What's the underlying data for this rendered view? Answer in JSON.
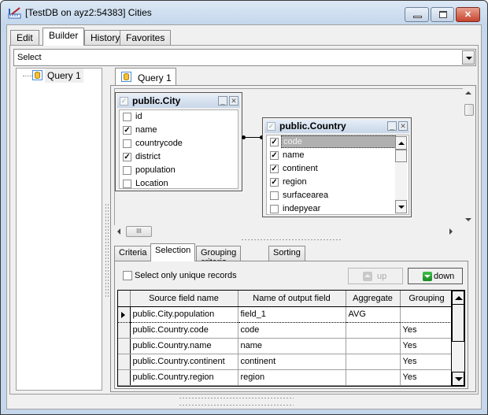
{
  "window": {
    "title": "[TestDB on ayz2:54383] Cities",
    "controls": {
      "minimize": "minimize",
      "maximize": "maximize",
      "close": "close"
    }
  },
  "top_tabs": [
    {
      "label": "Edit",
      "active": false
    },
    {
      "label": "Builder",
      "active": true
    },
    {
      "label": "History",
      "active": false
    },
    {
      "label": "Favorites",
      "active": false
    }
  ],
  "query_type": {
    "selected": "Select"
  },
  "tree": {
    "items": [
      {
        "label": "Query 1"
      }
    ]
  },
  "query_tab": {
    "label": "Query 1"
  },
  "diagram": {
    "tables": [
      {
        "name": "public.City",
        "fields": [
          {
            "name": "id",
            "checked": false
          },
          {
            "name": "name",
            "checked": true
          },
          {
            "name": "countrycode",
            "checked": false
          },
          {
            "name": "district",
            "checked": true
          },
          {
            "name": "population",
            "checked": false
          },
          {
            "name": "Location",
            "checked": false
          }
        ]
      },
      {
        "name": "public.Country",
        "fields": [
          {
            "name": "code",
            "checked": true,
            "selected": true
          },
          {
            "name": "name",
            "checked": true
          },
          {
            "name": "continent",
            "checked": true
          },
          {
            "name": "region",
            "checked": true
          },
          {
            "name": "surfacearea",
            "checked": false
          },
          {
            "name": "indepyear",
            "checked": false
          }
        ]
      }
    ],
    "hscroll_thumb_glyph": "III"
  },
  "bottom_tabs": [
    {
      "label": "Criteria",
      "active": false
    },
    {
      "label": "Selection",
      "active": true
    },
    {
      "label": "Grouping criteria",
      "active": false
    },
    {
      "label": "Sorting",
      "active": false
    }
  ],
  "selection": {
    "unique_label": "Select only unique records",
    "unique_checked": false,
    "up_label": "up",
    "down_label": "down",
    "columns": [
      "Source field name",
      "Name of output field",
      "Aggregate",
      "Grouping"
    ],
    "rows": [
      [
        "public.City.population",
        "field_1",
        "AVG",
        ""
      ],
      [
        "public.Country.code",
        "code",
        "",
        "Yes"
      ],
      [
        "public.Country.name",
        "name",
        "",
        "Yes"
      ],
      [
        "public.Country.continent",
        "continent",
        "",
        "Yes"
      ],
      [
        "public.Country.region",
        "region",
        "",
        "Yes"
      ]
    ]
  },
  "colors": {
    "title_bar": "#c4d7ec",
    "close_button": "#c6442f",
    "down_icon": "#1a8a22"
  }
}
